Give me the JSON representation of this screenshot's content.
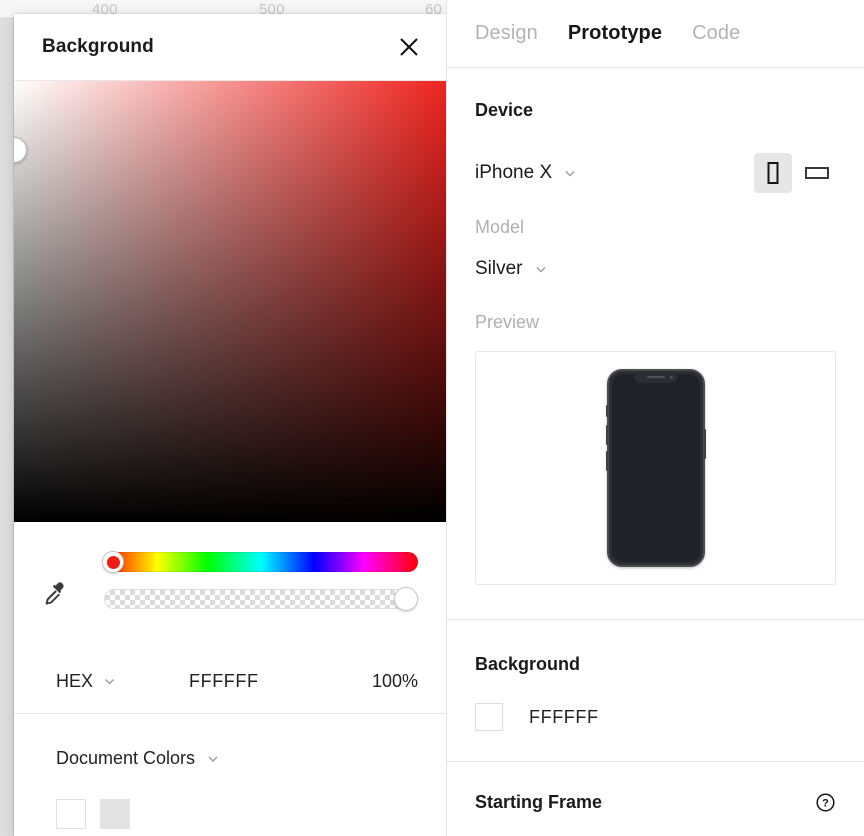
{
  "canvas": {
    "ruler_labels": [
      "400",
      "500",
      "60"
    ]
  },
  "color_picker": {
    "title": "Background",
    "close_icon": "close-icon",
    "eyedropper_icon": "eyedropper-icon",
    "hue_handle_color": "#F01C14",
    "sv_field": {
      "base_hue_color": "#EE2420",
      "handle_position": "top-left"
    },
    "hue_value_percent": 0,
    "alpha_value_percent": 100,
    "mode": {
      "label": "HEX",
      "chevron_icon": "chevron-down-icon"
    },
    "hex_value": "FFFFFF",
    "opacity_value": "100%",
    "document_colors": {
      "label": "Document Colors",
      "chevron_icon": "chevron-down-icon",
      "swatches": [
        {
          "name": "white-swatch",
          "hex": "#FFFFFF"
        },
        {
          "name": "light-gray-swatch",
          "hex": "#E3E3E3"
        }
      ]
    }
  },
  "properties": {
    "tabs": [
      {
        "label": "Design",
        "active": false
      },
      {
        "label": "Prototype",
        "active": true
      },
      {
        "label": "Code",
        "active": false
      }
    ],
    "device": {
      "title": "Device",
      "value": "iPhone X",
      "chevron_icon": "chevron-down-icon",
      "orientation": {
        "portrait_icon": "phone-portrait-icon",
        "landscape_icon": "phone-landscape-icon",
        "selected": "portrait"
      }
    },
    "model": {
      "label": "Model",
      "value": "Silver",
      "chevron_icon": "chevron-down-icon"
    },
    "preview": {
      "label": "Preview",
      "device_mockup": "iphone-x-mockup"
    },
    "background": {
      "title": "Background",
      "swatch_hex": "#FFFFFF",
      "hex_value": "FFFFFF"
    },
    "starting_frame": {
      "title": "Starting Frame",
      "help_icon": "help-circle-icon"
    }
  }
}
